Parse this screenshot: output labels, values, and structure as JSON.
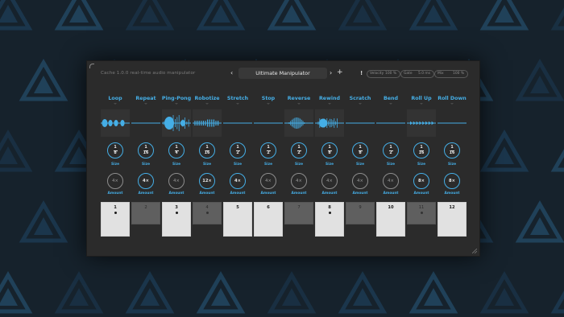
{
  "plugin": {
    "title": "Cache 1.0.0 real-time audio manipulator",
    "preset": "Ultimate Manipulator",
    "prev_icon": "chevron-left-icon",
    "next_icon": "chevron-right-icon",
    "add_label": "+",
    "alert_label": "!",
    "params": [
      {
        "name": "Velocity",
        "value": "100 %"
      },
      {
        "name": "Gate",
        "value": "5.0 ms"
      },
      {
        "name": "Mix",
        "value": "100 %"
      }
    ]
  },
  "effects": [
    {
      "label": "Loop",
      "size_num": "1",
      "size_den": "8",
      "amount": "4×",
      "amount_active": false,
      "wave": "loop"
    },
    {
      "label": "Repeat",
      "size_num": "1",
      "size_den": "16",
      "amount": "4×",
      "amount_active": true,
      "wave": "flat"
    },
    {
      "label": "Ping-Pong",
      "size_num": "1",
      "size_den": "4",
      "amount": "4×",
      "amount_active": false,
      "wave": "burst"
    },
    {
      "label": "Robotize",
      "size_num": "1",
      "size_den": "16",
      "amount": "12×",
      "amount_active": true,
      "wave": "robot"
    },
    {
      "label": "Stretch",
      "size_num": "1",
      "size_den": "2",
      "amount": "4×",
      "amount_active": true,
      "wave": "flat"
    },
    {
      "label": "Stop",
      "size_num": "1",
      "size_den": "2",
      "amount": "4×",
      "amount_active": false,
      "wave": "flat"
    },
    {
      "label": "Reverse",
      "size_num": "1",
      "size_den": "2",
      "amount": "4×",
      "amount_active": false,
      "wave": "reverse"
    },
    {
      "label": "Rewind",
      "size_num": "1",
      "size_den": "8",
      "amount": "4×",
      "amount_active": false,
      "wave": "rewind"
    },
    {
      "label": "Scratch",
      "size_num": "1",
      "size_den": "8",
      "amount": "4×",
      "amount_active": false,
      "wave": "flat"
    },
    {
      "label": "Bend",
      "size_num": "1",
      "size_den": "2",
      "amount": "4×",
      "amount_active": false,
      "wave": "flat"
    },
    {
      "label": "Roll Up",
      "size_num": "1",
      "size_den": "16",
      "amount": "8×",
      "amount_active": true,
      "wave": "rollup"
    },
    {
      "label": "Roll Down",
      "size_num": "1",
      "size_den": "16",
      "amount": "8×",
      "amount_active": true,
      "wave": "flat"
    }
  ],
  "size_caption": "Size",
  "amount_caption": "Amount",
  "pads": [
    {
      "label": "1",
      "dot": true,
      "type": "white"
    },
    {
      "label": "2",
      "dot": false,
      "type": "gray"
    },
    {
      "label": "3",
      "dot": true,
      "type": "white"
    },
    {
      "label": "4",
      "dot": true,
      "type": "gray"
    },
    {
      "label": "5",
      "dot": false,
      "type": "white"
    },
    {
      "label": "6",
      "dot": false,
      "type": "white"
    },
    {
      "label": "7",
      "dot": false,
      "type": "gray"
    },
    {
      "label": "8",
      "dot": true,
      "type": "white"
    },
    {
      "label": "9",
      "dot": false,
      "type": "gray"
    },
    {
      "label": "10",
      "dot": false,
      "type": "white"
    },
    {
      "label": "11",
      "dot": true,
      "type": "gray"
    },
    {
      "label": "12",
      "dot": false,
      "type": "white"
    }
  ],
  "colors": {
    "accent": "#45aee6",
    "panel": "#2b2b2b",
    "background": "#16222c"
  }
}
